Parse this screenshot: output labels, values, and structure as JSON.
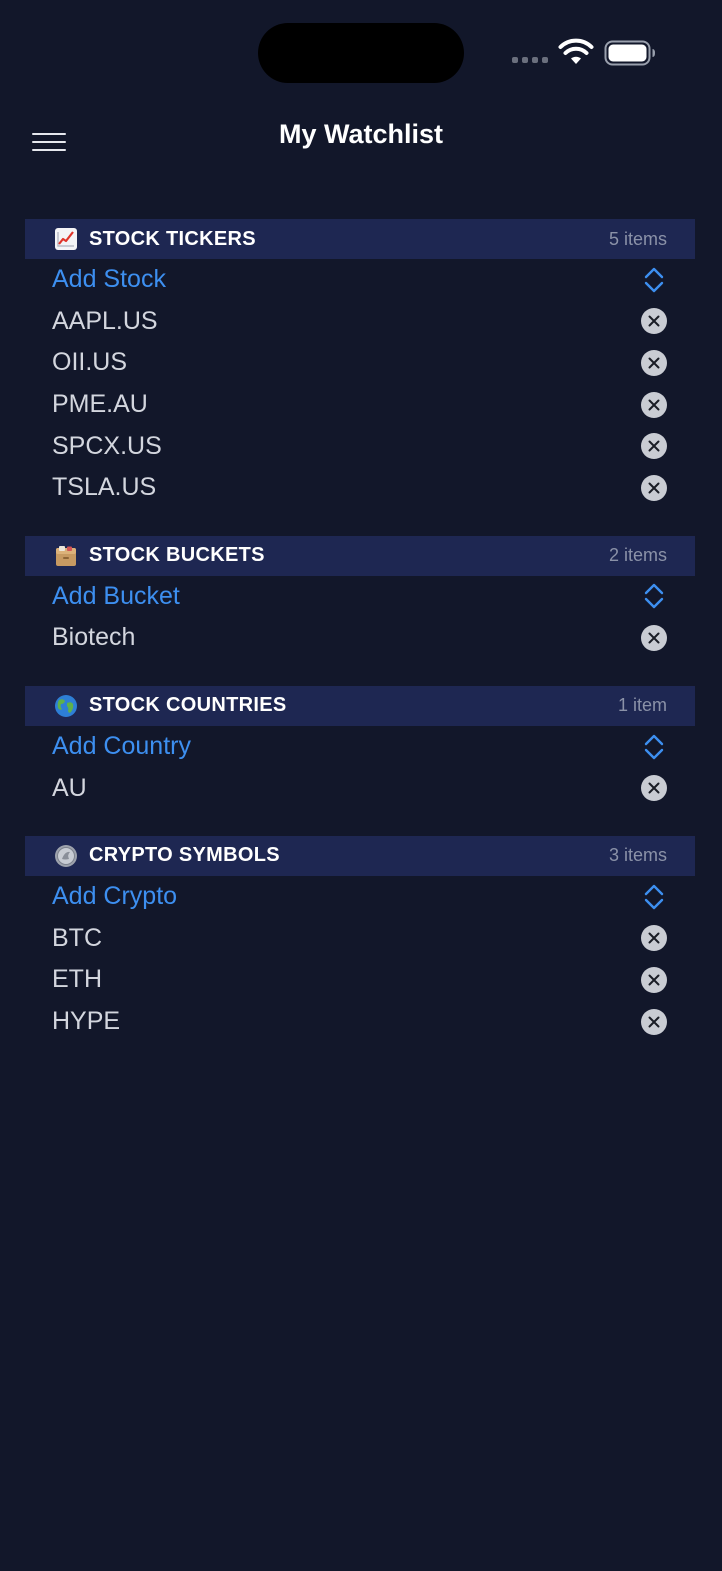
{
  "nav": {
    "title": "My Watchlist"
  },
  "sections": [
    {
      "title": "STOCK TICKERS",
      "count": "5 items",
      "emoji": "chart-increasing-icon",
      "add_label": "Add Stock",
      "items": [
        "AAPL.US",
        "OII.US",
        "PME.AU",
        "SPCX.US",
        "TSLA.US"
      ]
    },
    {
      "title": "STOCK BUCKETS",
      "count": "2 items",
      "emoji": "file-cabinet-icon",
      "add_label": "Add Bucket",
      "items": [
        "Biotech"
      ]
    },
    {
      "title": "STOCK COUNTRIES",
      "count": "1 item",
      "emoji": "globe-icon",
      "add_label": "Add Country",
      "items": [
        "AU"
      ]
    },
    {
      "title": "CRYPTO SYMBOLS",
      "count": "3 items",
      "emoji": "coin-icon",
      "add_label": "Add Crypto",
      "items": [
        "BTC",
        "ETH",
        "HYPE"
      ]
    }
  ],
  "colors": {
    "background": "#12172a",
    "section_header": "#1e2752",
    "accent": "#3d8ff0",
    "text": "#d3d6de"
  }
}
